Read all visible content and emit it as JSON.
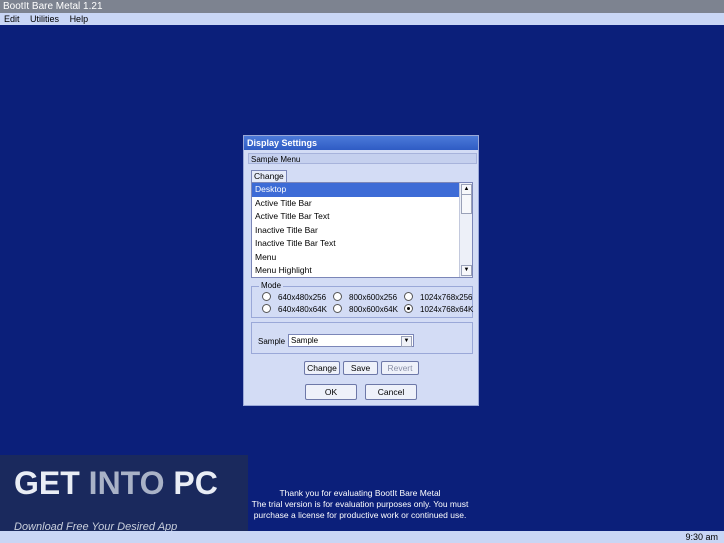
{
  "app": {
    "title": "BootIt Bare Metal 1.21"
  },
  "menu": {
    "items": [
      "Edit",
      "Utilities",
      "Help"
    ]
  },
  "dialog": {
    "title": "Display Settings",
    "sample_menu": "Sample Menu",
    "change_tab": "Change",
    "list_items": [
      "Desktop",
      "Active Title Bar",
      "Active Title Bar Text",
      "Inactive Title Bar",
      "Inactive Title Bar Text",
      "Menu",
      "Menu Highlight"
    ],
    "selected_index": 0,
    "mode_legend": "Mode",
    "modes": [
      "640x480x256",
      "800x600x256",
      "1024x768x256",
      "640x480x64K",
      "800x600x64K",
      "1024x768x64K"
    ],
    "selected_mode": "1024x768x64K",
    "sample_label": "Sample",
    "sample_value": "Sample",
    "buttons": {
      "change": "Change",
      "save": "Save",
      "revert": "Revert",
      "ok": "OK",
      "cancel": "Cancel"
    }
  },
  "watermark": {
    "get": "GET ",
    "into": "INTO",
    "pc": " PC",
    "sub": "Download Free Your Desired App"
  },
  "notice": {
    "line1": "Thank you for evaluating BootIt Bare Metal",
    "line2": "The trial version is for evaluation purposes only.  You must",
    "line3": "purchase a license for productive work or continued use."
  },
  "status": {
    "clock": "9:30 am"
  },
  "colors": {
    "desktop": "#0b1f7a",
    "selection": "#3d6bd6"
  }
}
